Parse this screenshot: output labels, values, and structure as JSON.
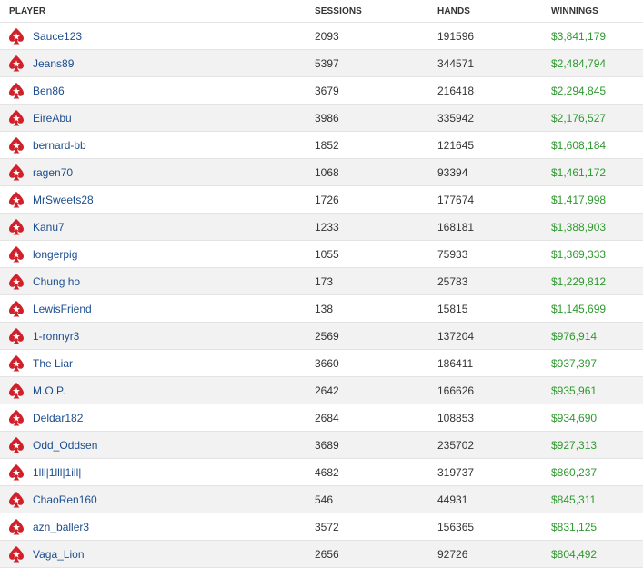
{
  "header": {
    "player": "PLAYER",
    "sessions": "SESSIONS",
    "hands": "HANDS",
    "winnings": "WINNINGS"
  },
  "colors": {
    "link": "#1d4e8f",
    "money": "#2e9a2e",
    "icon": "#d0202a"
  },
  "icon": "pokerstars-spade-icon",
  "rows": [
    {
      "player": "Sauce123",
      "sessions": "2093",
      "hands": "191596",
      "winnings": "$3,841,179"
    },
    {
      "player": "Jeans89",
      "sessions": "5397",
      "hands": "344571",
      "winnings": "$2,484,794"
    },
    {
      "player": "Ben86",
      "sessions": "3679",
      "hands": "216418",
      "winnings": "$2,294,845"
    },
    {
      "player": "EireAbu",
      "sessions": "3986",
      "hands": "335942",
      "winnings": "$2,176,527"
    },
    {
      "player": "bernard-bb",
      "sessions": "1852",
      "hands": "121645",
      "winnings": "$1,608,184"
    },
    {
      "player": "ragen70",
      "sessions": "1068",
      "hands": "93394",
      "winnings": "$1,461,172"
    },
    {
      "player": "MrSweets28",
      "sessions": "1726",
      "hands": "177674",
      "winnings": "$1,417,998"
    },
    {
      "player": "Kanu7",
      "sessions": "1233",
      "hands": "168181",
      "winnings": "$1,388,903"
    },
    {
      "player": "longerpig",
      "sessions": "1055",
      "hands": "75933",
      "winnings": "$1,369,333"
    },
    {
      "player": "Chung ho",
      "sessions": "173",
      "hands": "25783",
      "winnings": "$1,229,812"
    },
    {
      "player": "LewisFriend",
      "sessions": "138",
      "hands": "15815",
      "winnings": "$1,145,699"
    },
    {
      "player": "1-ronnyr3",
      "sessions": "2569",
      "hands": "137204",
      "winnings": "$976,914"
    },
    {
      "player": "The Liar",
      "sessions": "3660",
      "hands": "186411",
      "winnings": "$937,397"
    },
    {
      "player": "M.O.P.",
      "sessions": "2642",
      "hands": "166626",
      "winnings": "$935,961"
    },
    {
      "player": "Deldar182",
      "sessions": "2684",
      "hands": "108853",
      "winnings": "$934,690"
    },
    {
      "player": "Odd_Oddsen",
      "sessions": "3689",
      "hands": "235702",
      "winnings": "$927,313"
    },
    {
      "player": "1lll|1lll|1ill|",
      "sessions": "4682",
      "hands": "319737",
      "winnings": "$860,237"
    },
    {
      "player": "ChaoRen160",
      "sessions": "546",
      "hands": "44931",
      "winnings": "$845,311"
    },
    {
      "player": "azn_baller3",
      "sessions": "3572",
      "hands": "156365",
      "winnings": "$831,125"
    },
    {
      "player": "Vaga_Lion",
      "sessions": "2656",
      "hands": "92726",
      "winnings": "$804,492"
    }
  ]
}
